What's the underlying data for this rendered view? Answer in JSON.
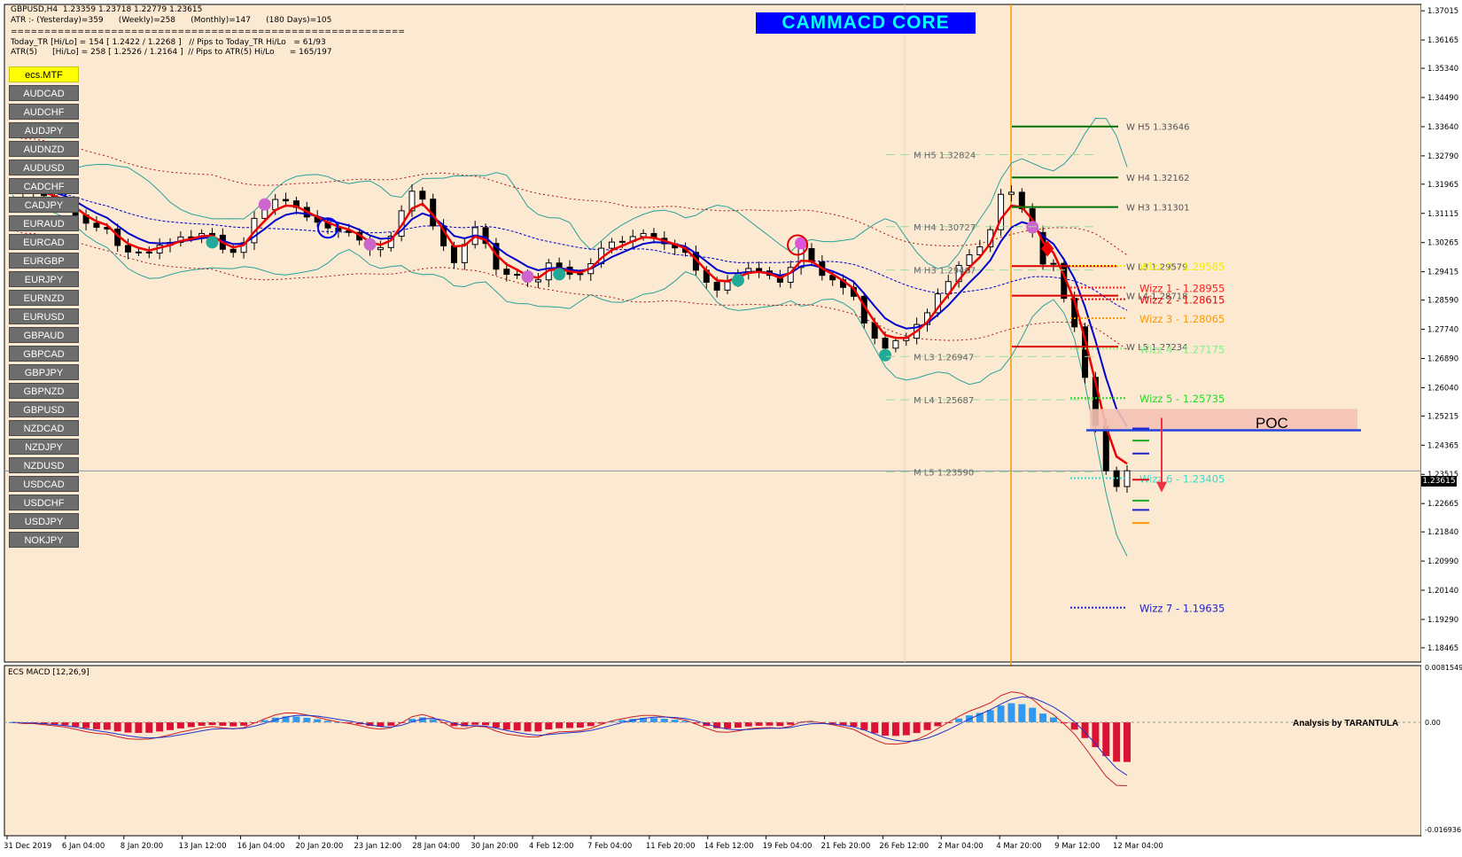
{
  "chart": {
    "header_line": "GBPUSD,H4  1.23359 1.23718 1.22779 1.23615",
    "atr_line": "ATR :- (Yesterday)=359      (Weekly)=258      (Monthly)=147      (180 Days)=105",
    "separator": "===========================================================",
    "today_tr_line": "Today_TR [Hi/Lo] = 154 [ 1.2422 / 1.2268 ]   // Pips to Today_TR Hi/Lo   = 61/93",
    "atr5_line": "ATR(5)      [Hi/Lo] = 258 [ 1.2526 / 1.2164 ]  // Pips to ATR(5) Hi/Lo      = 165/197",
    "watermark": "CAMMACD CORE",
    "poc_label": "POC",
    "current_price": "1.23615",
    "analysis_credit": "Analysis by TARANTULA",
    "macd_title": "ECS MACD [12,26,9]"
  },
  "symbols": {
    "active": "ecs.MTF",
    "list": [
      "AUDCAD",
      "AUDCHF",
      "AUDJPY",
      "AUDNZD",
      "AUDUSD",
      "CADCHF",
      "CADJPY",
      "EURAUD",
      "EURCAD",
      "EURGBP",
      "EURJPY",
      "EURNZD",
      "EURUSD",
      "GBPAUD",
      "GBPCAD",
      "GBPJPY",
      "GBPNZD",
      "GBPUSD",
      "NZDCAD",
      "NZDJPY",
      "NZDUSD",
      "USDCAD",
      "USDCHF",
      "USDJPY",
      "NOKJPY"
    ]
  },
  "price_axis": [
    "1.37015",
    "1.36165",
    "1.35340",
    "1.34490",
    "1.33640",
    "1.32790",
    "1.31965",
    "1.31115",
    "1.30265",
    "1.29415",
    "1.28590",
    "1.27740",
    "1.26890",
    "1.26040",
    "1.25215",
    "1.24365",
    "1.23515",
    "1.22665",
    "1.21840",
    "1.20990",
    "1.20140",
    "1.19290",
    "1.18465"
  ],
  "macd_axis": {
    "top": "0.0081549",
    "zero": "0.00",
    "bottom": "-0.016936"
  },
  "time_axis": [
    "31 Dec 2019",
    "6 Jan 04:00",
    "8 Jan 20:00",
    "13 Jan 12:00",
    "16 Jan 04:00",
    "20 Jan 20:00",
    "23 Jan 12:00",
    "28 Jan 04:00",
    "30 Jan 20:00",
    "4 Feb 12:00",
    "7 Feb 04:00",
    "11 Feb 20:00",
    "14 Feb 12:00",
    "19 Feb 04:00",
    "21 Feb 20:00",
    "26 Feb 12:00",
    "2 Mar 04:00",
    "4 Mar 20:00",
    "9 Mar 12:00",
    "12 Mar 04:00"
  ],
  "monthly_pivots": [
    {
      "label": "M  H5 1.32824",
      "price": 1.32824
    },
    {
      "label": "M  H4 1.30727",
      "price": 1.30727
    },
    {
      "label": "M  H3 1.29467",
      "price": 1.29467
    },
    {
      "label": "M  L3 1.26947",
      "price": 1.26947
    },
    {
      "label": "M  L4 1.25687",
      "price": 1.25687
    },
    {
      "label": "M  L5 1.23590",
      "price": 1.2359
    }
  ],
  "weekly_pivots": [
    {
      "label": "W  H5 1.33646",
      "price": 1.33646,
      "color": "#007000"
    },
    {
      "label": "W  H4 1.32162",
      "price": 1.32162,
      "color": "#007000"
    },
    {
      "label": "W  H3 1.31301",
      "price": 1.31301,
      "color": "#007000"
    },
    {
      "label": "W  L3 1.29579",
      "price": 1.29579,
      "color": "#dd0000"
    },
    {
      "label": "W  L4 1.28718",
      "price": 1.28718,
      "color": "#dd0000"
    },
    {
      "label": "W  L5 1.27234",
      "price": 1.27234,
      "color": "#dd0000"
    }
  ],
  "wizz_levels": [
    {
      "label": "Wizz 0 - 1.29585",
      "price": 1.29585,
      "color": "#f0f000"
    },
    {
      "label": "Wizz 1 - 1.28955",
      "price": 1.28955,
      "color": "#ff2020"
    },
    {
      "label": "Wizz 2 - 1.28615",
      "price": 1.28615,
      "color": "#dd1010"
    },
    {
      "label": "Wizz 3 - 1.28065",
      "price": 1.28065,
      "color": "#ff9900"
    },
    {
      "label": "Wizz 4 - 1.27175",
      "price": 1.27175,
      "color": "#88ee88"
    },
    {
      "label": "Wizz 5 - 1.25735",
      "price": 1.25735,
      "color": "#22dd22"
    },
    {
      "label": "Wizz 6 - 1.23405",
      "price": 1.23405,
      "color": "#33ddcc"
    },
    {
      "label": "Wizz 7 - 1.19635",
      "price": 1.19635,
      "color": "#2222cc"
    }
  ],
  "poc_price": 1.248,
  "colors": {
    "chart_bg": "#fbe9d2",
    "candles": "#000000",
    "fast_ma": "#ee0000",
    "slow_ma": "#0000cc",
    "bands": "#2aa198",
    "envelope": "#b01010",
    "vline": "#ff9900",
    "macd_up": "#3399ee",
    "macd_down": "#dd1133",
    "watermark_bg": "#0000ff",
    "watermark_fg": "#00ffff"
  },
  "close_series": [
    1.3195,
    1.3172,
    1.3183,
    1.3163,
    1.3152,
    1.3139,
    1.3107,
    1.3083,
    1.3071,
    1.3066,
    1.3018,
    1.2999,
    1.2999,
    1.2996,
    1.3019,
    1.3027,
    1.3043,
    1.3043,
    1.3053,
    1.3048,
    1.3007,
    1.2998,
    1.3026,
    1.3097,
    1.3122,
    1.3152,
    1.3148,
    1.3129,
    1.3101,
    1.3086,
    1.3069,
    1.3061,
    1.3056,
    1.3034,
    1.3006,
    1.3012,
    1.3045,
    1.3119,
    1.3176,
    1.3153,
    1.3075,
    1.3017,
    1.2968,
    1.3021,
    1.307,
    1.3024,
    1.2949,
    1.2934,
    1.2932,
    1.2912,
    1.2918,
    1.2967,
    1.2955,
    1.2934,
    1.2936,
    1.2965,
    1.301,
    1.3028,
    1.303,
    1.3044,
    1.3053,
    1.3039,
    1.3023,
    1.3011,
    1.2998,
    1.2946,
    1.2911,
    1.2888,
    1.2912,
    1.2937,
    1.2951,
    1.2944,
    1.2931,
    1.2911,
    1.2954,
    1.3009,
    1.297,
    1.2931,
    1.2918,
    1.2896,
    1.287,
    1.2792,
    1.2748,
    1.2719,
    1.2741,
    1.2748,
    1.2788,
    1.2822,
    1.2877,
    1.2913,
    1.296,
    1.2991,
    1.3014,
    1.3064,
    1.3167,
    1.3173,
    1.3125,
    1.3056,
    1.2964,
    1.2966,
    1.2864,
    1.2781,
    1.2634,
    1.2494,
    1.2362,
    1.2316,
    1.2362
  ]
}
